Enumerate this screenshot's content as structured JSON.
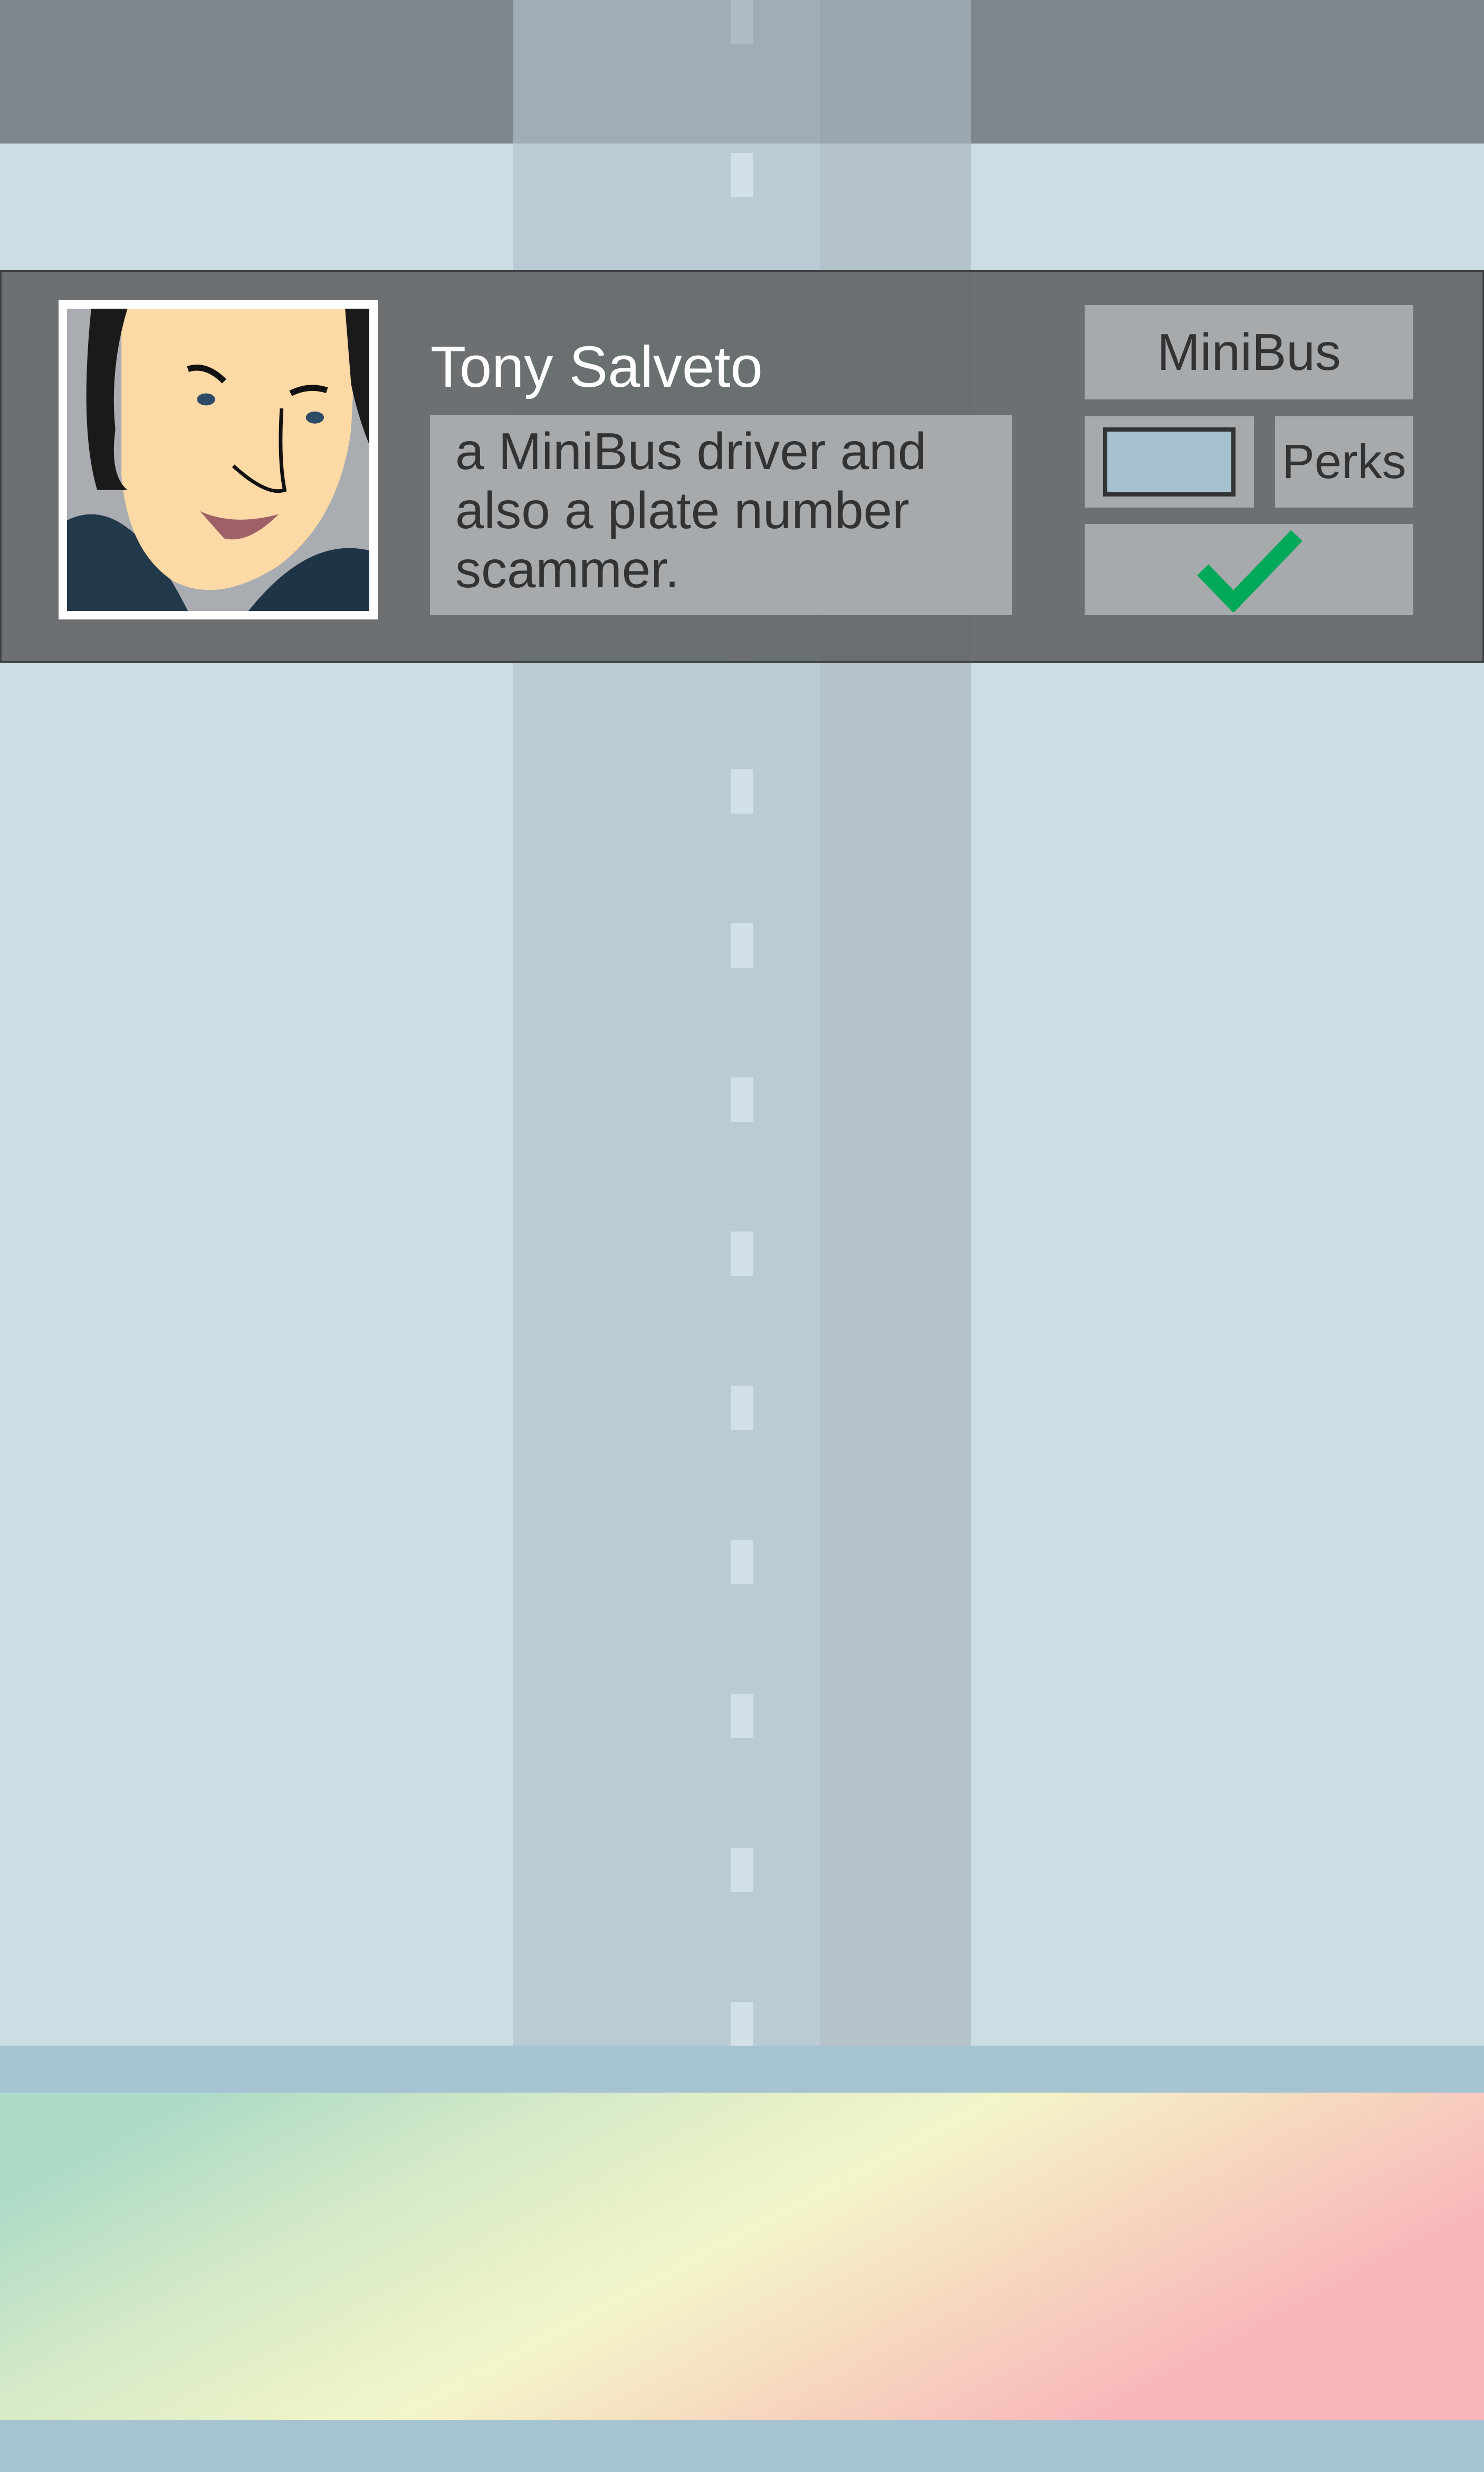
{
  "profile": {
    "name": "Tony Salveto",
    "description": "a MiniBus driver and also a plate number scammer."
  },
  "buttons": {
    "vehicle_label": "MiniBus",
    "perks_label": "Perks",
    "confirm_icon": "checkmark-icon"
  },
  "colors": {
    "top_bar": "#7f858d",
    "background": "#cbdde5",
    "card": "#6e7175",
    "button": "#a7aaad",
    "check": "#00a859",
    "bottom_bar": "#a6c3d2"
  }
}
